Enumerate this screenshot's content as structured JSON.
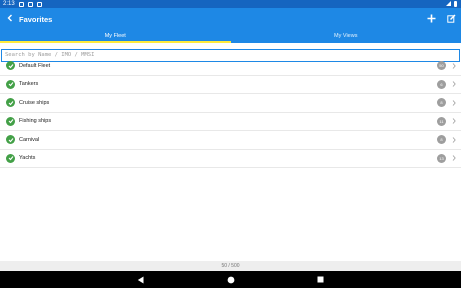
{
  "status_bar": {
    "time": "2:13"
  },
  "app_bar": {
    "title": "Favorites",
    "back_glyph": "<"
  },
  "tabs": [
    {
      "label": "My Fleet",
      "active": true
    },
    {
      "label": "My Views",
      "active": false
    }
  ],
  "search": {
    "placeholder": "Search by Name / IMO / MMSI",
    "value": ""
  },
  "fleets": [
    {
      "name": "Default Fleet",
      "count": "50"
    },
    {
      "name": "Tankers",
      "count": "6"
    },
    {
      "name": "Cruise ships",
      "count": "8"
    },
    {
      "name": "Fishing ships",
      "count": "11"
    },
    {
      "name": "Carnival",
      "count": "8"
    },
    {
      "name": "Yachts",
      "count": "13"
    }
  ],
  "footer": {
    "usage": "50 / 500"
  },
  "colors": {
    "primary": "#1e88e5",
    "tab_indicator": "#ffeb3b",
    "check": "#43a047",
    "badge": "#9e9e9e"
  },
  "icons": {
    "back": "arrow-back-icon",
    "add": "plus-icon",
    "edit": "edit-icon",
    "check": "check-circle-icon",
    "chevron": "chevron-right-icon"
  }
}
